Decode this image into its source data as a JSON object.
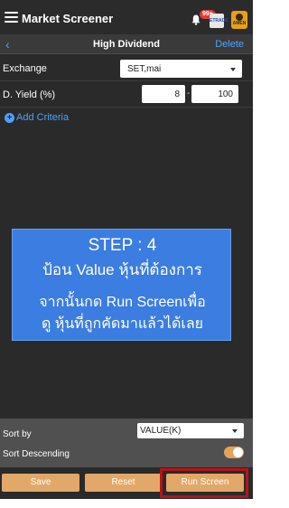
{
  "app": {
    "title": "Market Screener",
    "notification_badge": "99+",
    "broker_logo": "ETRADE",
    "avatar_label": "AMEN"
  },
  "subheader": {
    "back_icon": "chevron-left-icon",
    "title": "High Dividend",
    "delete_label": "Delete"
  },
  "criteria": {
    "exchange": {
      "label": "Exchange",
      "value": "SET,mai"
    },
    "dividend_yield": {
      "label": "D. Yield (%)",
      "min": "8",
      "separator": "-",
      "max": "100"
    },
    "add_label": "Add Criteria"
  },
  "step_overlay": {
    "line1": "STEP : 4",
    "line2": "ป้อน Value หุ้นที่ต้องการ",
    "line3": "จากนั้นกด Run Screenเพื่อ",
    "line4": "ดู หุ้นที่ถูกคัดมาแล้วได้เลย",
    "color": "#3b7de0"
  },
  "sort": {
    "sort_by_label": "Sort by",
    "sort_by_value": "VALUE(K)",
    "descending_label": "Sort Descending",
    "descending_on": true
  },
  "buttons": {
    "save": "Save",
    "reset": "Reset",
    "run": "Run Screen"
  },
  "colors": {
    "accent_blue": "#4aa3ff",
    "button": "#e2a869",
    "highlight": "#b5141a"
  }
}
